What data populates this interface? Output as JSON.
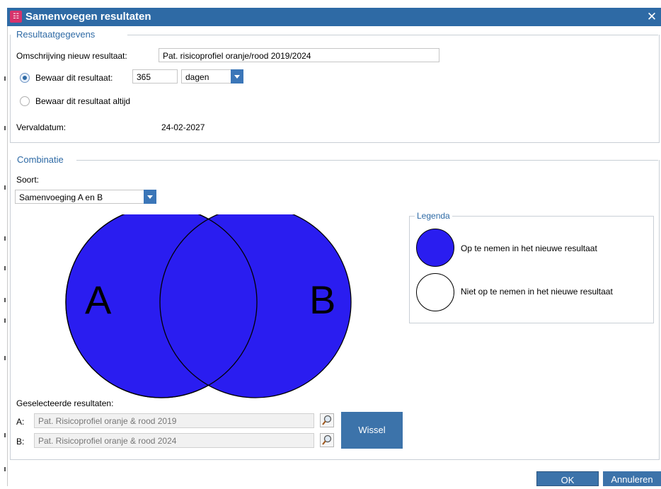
{
  "window": {
    "title": "Samenvoegen resultaten",
    "close_glyph": "✕",
    "app_icon": "app-icon"
  },
  "resultaat": {
    "legend": "Resultaatgegevens",
    "omschrijving_label": "Omschrijving nieuw resultaat:",
    "omschrijving_value": "Pat. risicoprofiel oranje/rood 2019/2024",
    "bewaar_label": "Bewaar dit resultaat:",
    "bewaar_days": "365",
    "bewaar_unit": "dagen",
    "bewaar_altijd_label": "Bewaar dit resultaat altijd",
    "vervaldatum_label": "Vervaldatum:",
    "vervaldatum_value": "24-02-2027",
    "selected_option": "bewaar-dagen"
  },
  "combinatie": {
    "legend": "Combinatie",
    "soort_label": "Soort:",
    "soort_value": "Samenvoeging A en B",
    "venn": {
      "label_a": "A",
      "label_b": "B",
      "fill": "#2a1df0"
    },
    "legenda": {
      "title": "Legenda",
      "included_label": "Op te nemen in het nieuwe resultaat",
      "excluded_label": "Niet op te nemen in het nieuwe resultaat",
      "included_color": "#2a1df0",
      "excluded_color": "#ffffff"
    },
    "geselecteerde_label": "Geselecteerde resultaten:",
    "a_label": "A:",
    "a_value": "Pat. Risicoprofiel oranje & rood 2019",
    "b_label": "B:",
    "b_value": "Pat. Risicoprofiel oranje & rood 2024",
    "wissel_label": "Wissel"
  },
  "footer": {
    "ok_label": "OK",
    "cancel_label": "Annuleren"
  }
}
